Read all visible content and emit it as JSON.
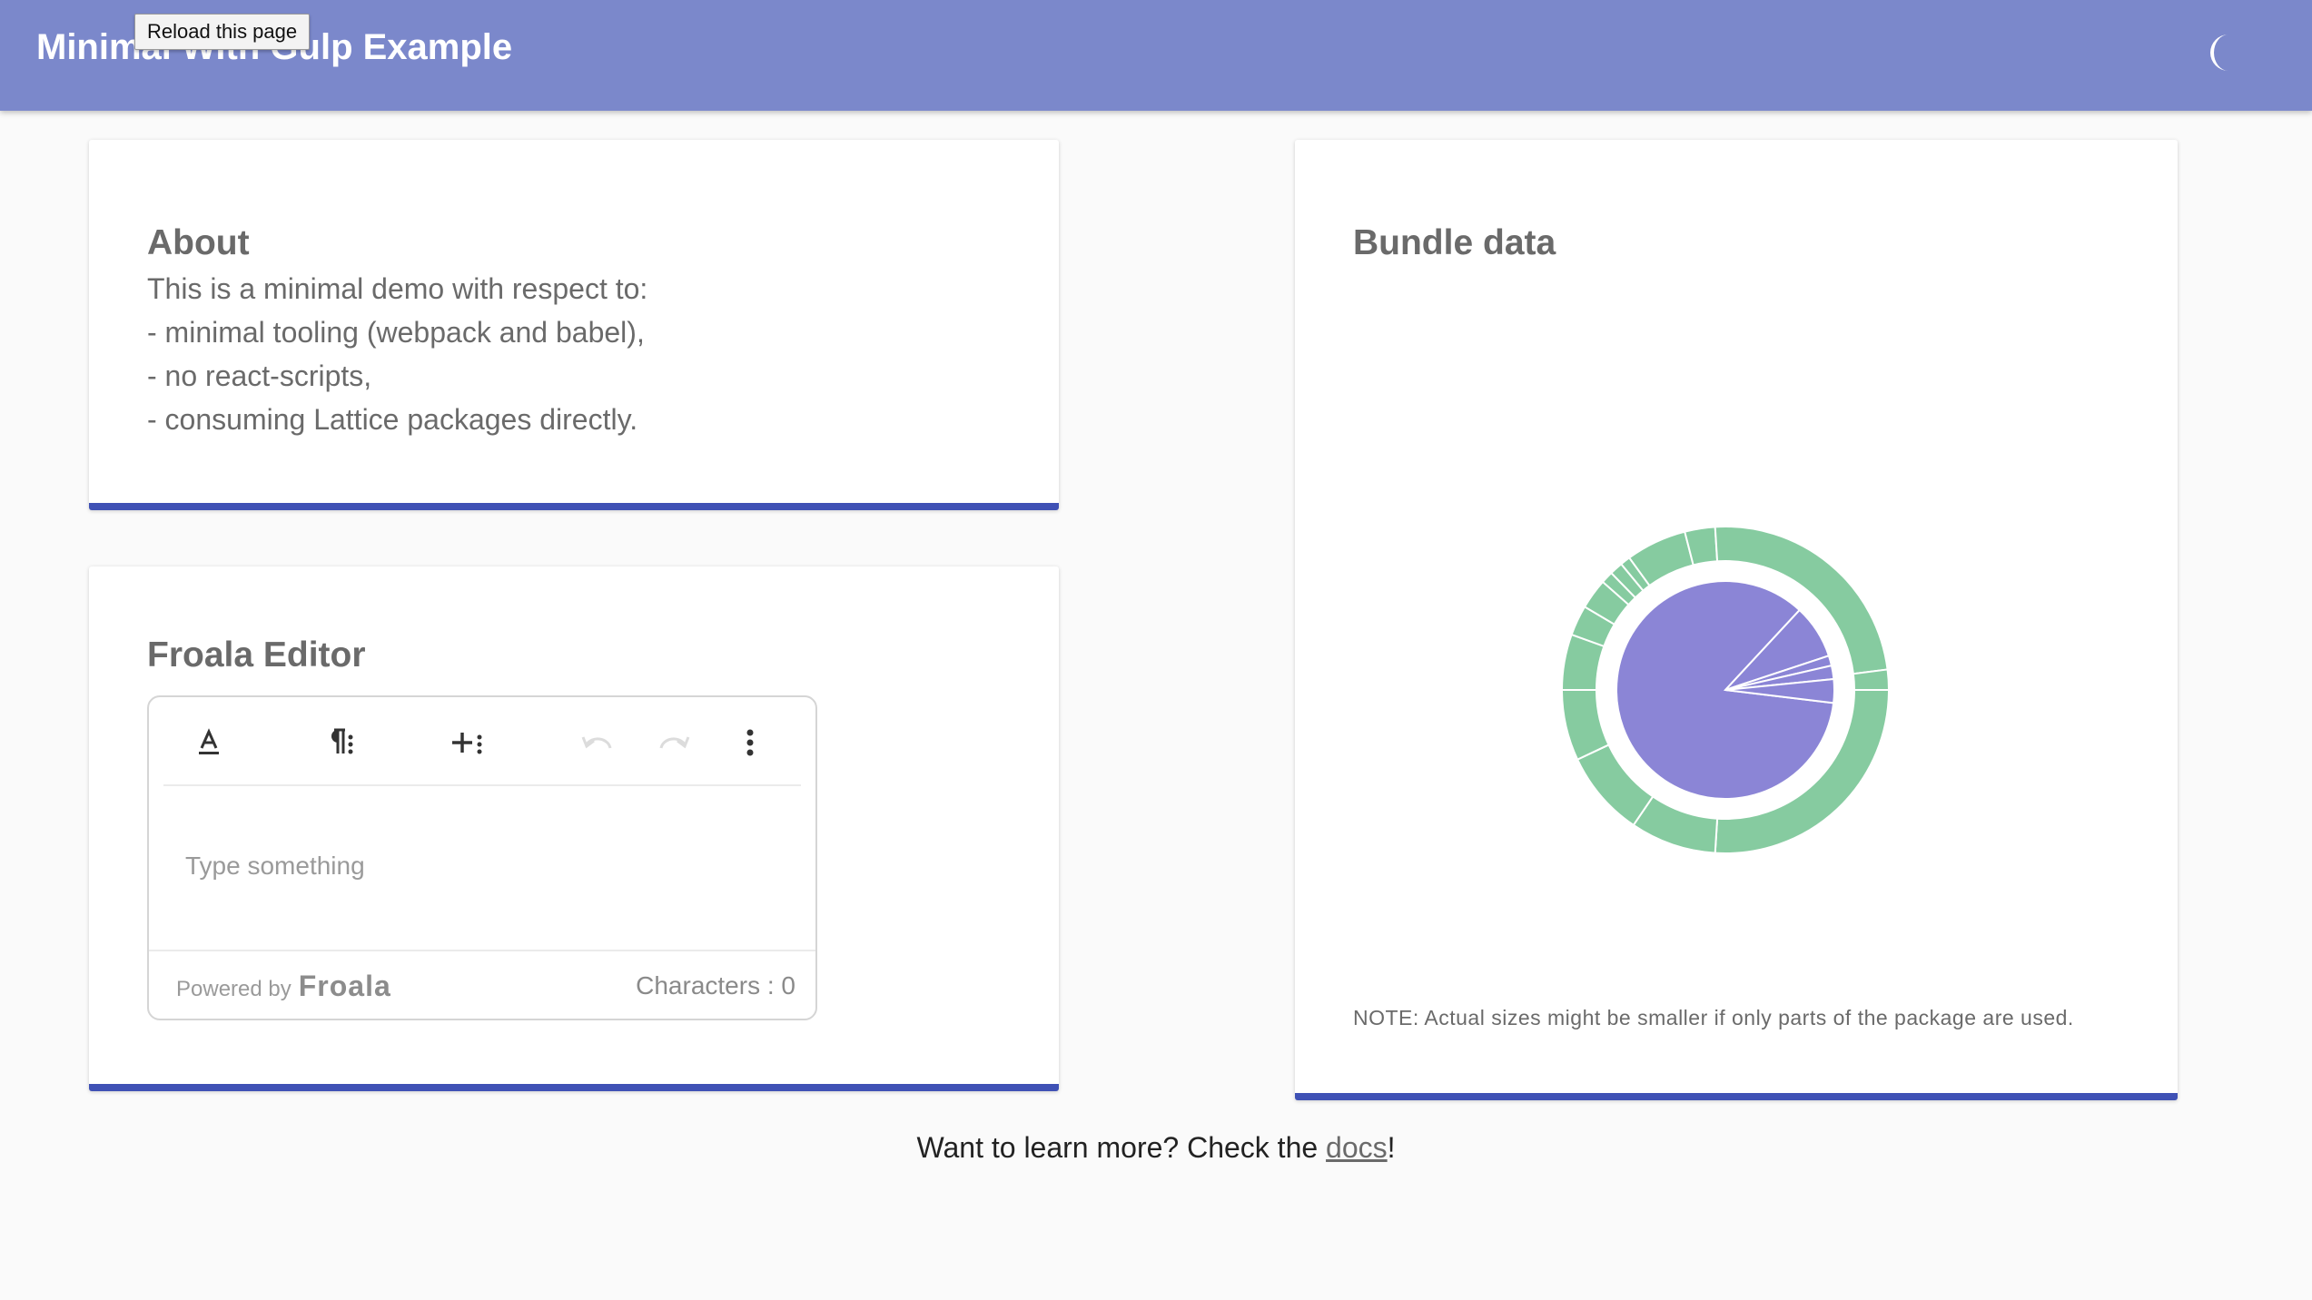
{
  "appbar": {
    "title": "Minimal With Gulp Example",
    "tooltip": "Reload this page",
    "theme_toggle_icon": "crescent-moon-icon",
    "background": "#7b88cb"
  },
  "about": {
    "title": "About",
    "lines": [
      "This is a minimal demo with respect to:",
      "- minimal tooling (webpack and babel),",
      "- no react-scripts,",
      "- consuming Lattice packages directly."
    ]
  },
  "editor_card": {
    "title": "Froala Editor",
    "toolbar": [
      {
        "name": "text-color-icon",
        "enabled": true
      },
      {
        "name": "paragraph-format-icon",
        "enabled": true
      },
      {
        "name": "insert-more-icon",
        "enabled": true
      },
      {
        "name": "undo-icon",
        "enabled": false
      },
      {
        "name": "redo-icon",
        "enabled": false
      },
      {
        "name": "more-options-icon",
        "enabled": true
      }
    ],
    "placeholder": "Type something",
    "powered_by": "Powered by",
    "brand": "Froala",
    "char_count": "Characters : 0"
  },
  "bundle": {
    "title": "Bundle data",
    "note": "NOTE: Actual sizes might be smaller if only parts of the package are used."
  },
  "footer": {
    "text": "Want to learn more? Check the ",
    "link": "docs",
    "suffix": "!"
  },
  "colors": {
    "accent": "#3f51b5",
    "inner_ring": "#8b85d6",
    "outer_ring": "#86cba0"
  },
  "chart_data": {
    "type": "pie",
    "description_level": "sunburst",
    "inner": [
      0.85,
      0.08,
      0.015,
      0.02,
      0.035
    ],
    "outer": [
      0.26,
      0.085,
      0.085,
      0.07,
      0.055,
      0.03,
      0.03,
      0.012,
      0.013,
      0.01,
      0.06,
      0.03,
      0.24,
      0.02
    ]
  }
}
